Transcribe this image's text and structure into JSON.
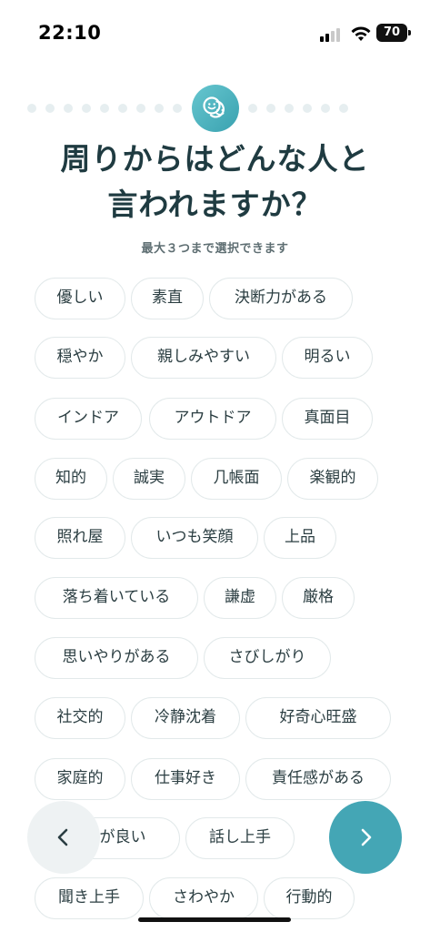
{
  "status_bar": {
    "time": "22:10",
    "battery": "70",
    "icons": [
      "signal-icon",
      "wifi-icon",
      "battery-icon"
    ]
  },
  "progress": {
    "total_steps": 20,
    "current_step": 10,
    "badge_icon": "faces-icon",
    "accent_color": "#44a6b5"
  },
  "question": {
    "title_line1": "周りからはどんな人と",
    "title_line2": "言われますか？",
    "subtitle": "最大３つまで選択できます"
  },
  "options": [
    "優しい",
    "素直",
    "決断力がある",
    "穏やか",
    "親しみやすい",
    "明るい",
    "インドア",
    "アウトドア",
    "真面目",
    "知的",
    "誠実",
    "几帳面",
    "楽観的",
    "照れ屋",
    "いつも笑顔",
    "上品",
    "落ち着いている",
    "謙虚",
    "厳格",
    "思いやりがある",
    "さびしがり",
    "社交的",
    "冷静沈着",
    "好奇心旺盛",
    "家庭的",
    "仕事好き",
    "責任感がある",
    "要領が良い",
    "話し上手",
    "聞き上手",
    "さわやか",
    "行動的"
  ],
  "navigation": {
    "back_icon": "chevron-left-icon",
    "next_icon": "chevron-right-icon"
  }
}
